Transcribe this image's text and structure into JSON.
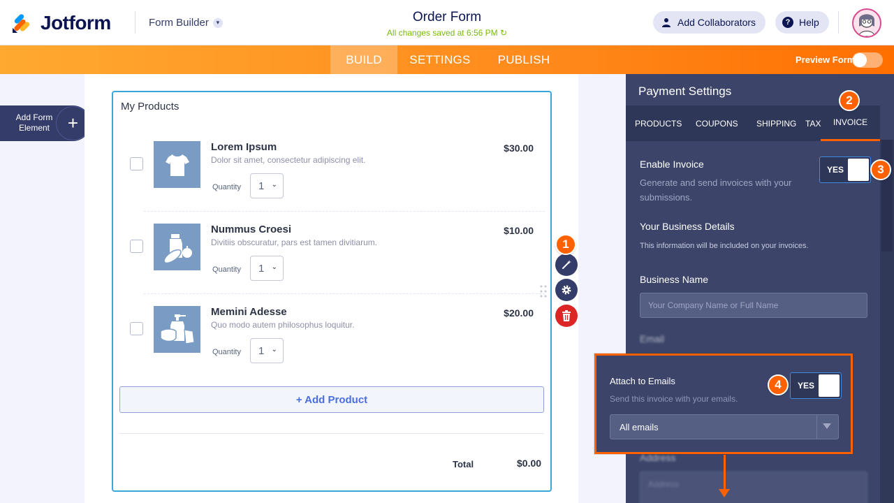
{
  "header": {
    "logo_text": "Jotform",
    "form_builder_label": "Form Builder",
    "form_title": "Order Form",
    "save_status": "All changes saved at 6:56 PM",
    "add_collaborators_label": "Add Collaborators",
    "help_label": "Help"
  },
  "nav": {
    "tabs": [
      "BUILD",
      "SETTINGS",
      "PUBLISH"
    ],
    "active_tab": "BUILD",
    "preview_label": "Preview Form"
  },
  "sidebar": {
    "add_element_label": "Add Form Element"
  },
  "form": {
    "widget_title": "My Products",
    "quantity_label": "Quantity",
    "products": [
      {
        "name": "Lorem Ipsum",
        "description": "Dolor sit amet, consectetur adipiscing elit.",
        "price": "$30.00",
        "quantity": "1",
        "icon": "tshirt-icon"
      },
      {
        "name": "Nummus Croesi",
        "description": "Divitiis obscuratur, pars est tamen divitiarum.",
        "price": "$10.00",
        "quantity": "1",
        "icon": "groceries-icon"
      },
      {
        "name": "Memini Adesse",
        "description": "Quo modo autem philosophus loquitur.",
        "price": "$20.00",
        "quantity": "1",
        "icon": "hygiene-icon"
      }
    ],
    "add_product_label": "+ Add Product",
    "total_label": "Total",
    "total_value": "$0.00"
  },
  "badges": [
    "1",
    "2",
    "3",
    "4"
  ],
  "panel": {
    "title": "Payment Settings",
    "tabs": [
      "PRODUCTS",
      "COUPONS",
      "SHIPPING",
      "TAX",
      "INVOICE"
    ],
    "active_tab": "INVOICE",
    "enable_invoice_label": "Enable Invoice",
    "enable_invoice_value": "YES",
    "enable_invoice_desc": "Generate and send invoices with your submissions.",
    "business_details_title": "Your Business Details",
    "business_details_desc": "This information will be included on your invoices.",
    "business_name_label": "Business Name",
    "business_name_placeholder": "Your Company Name or Full Name",
    "email_label": "Email",
    "address_label": "Address",
    "address_placeholder": "Address",
    "attach_label": "Attach to Emails",
    "attach_value": "YES",
    "attach_desc": "Send this invoice with your emails.",
    "attach_select_value": "All emails"
  },
  "colors": {
    "brand_orange": "#ff6100",
    "navy": "#0a1551",
    "panel_bg": "#3c4569",
    "accent_blue": "#3ba7d9",
    "delete_red": "#dc2626"
  }
}
